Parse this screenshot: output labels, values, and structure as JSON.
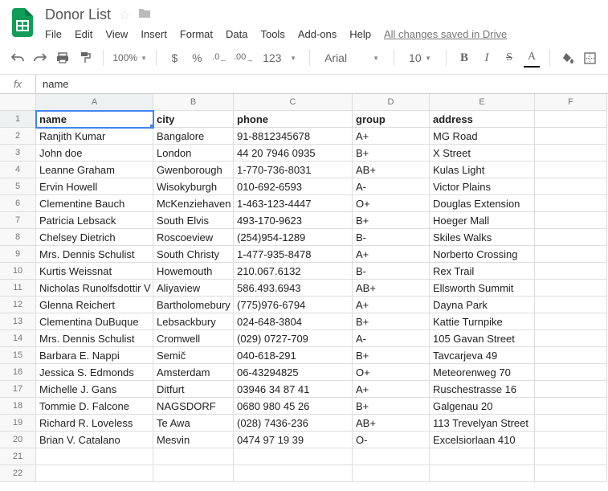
{
  "doc": {
    "title": "Donor List"
  },
  "menu": {
    "file": "File",
    "edit": "Edit",
    "view": "View",
    "insert": "Insert",
    "format": "Format",
    "data": "Data",
    "tools": "Tools",
    "addons": "Add-ons",
    "help": "Help",
    "saved": "All changes saved in Drive"
  },
  "toolbar": {
    "zoom": "100%",
    "currency": "$",
    "percent": "%",
    "dec_dec": ".0",
    "dec_inc": ".00",
    "numfmt": "123",
    "font": "Arial",
    "size": "10",
    "bold": "B",
    "italic": "I",
    "strike": "S",
    "textcolor": "A"
  },
  "formula": {
    "fx": "fx",
    "value": "name"
  },
  "columns": [
    "A",
    "B",
    "C",
    "D",
    "E",
    "F"
  ],
  "rownums": [
    "1",
    "2",
    "3",
    "4",
    "5",
    "6",
    "7",
    "8",
    "9",
    "10",
    "11",
    "12",
    "13",
    "14",
    "15",
    "16",
    "17",
    "18",
    "19",
    "20",
    "21",
    "22"
  ],
  "headers": {
    "name": "name",
    "city": "city",
    "phone": "phone",
    "group": "group",
    "address": "address"
  },
  "rows": [
    {
      "name": "Ranjith Kumar",
      "city": "Bangalore",
      "phone": "91-8812345678",
      "group": "A+",
      "address": "MG Road"
    },
    {
      "name": "John doe",
      "city": "London",
      "phone": "44 20 7946 0935",
      "group": "B+",
      "address": "X Street"
    },
    {
      "name": "Leanne Graham",
      "city": "Gwenborough",
      "phone": "1-770-736-8031",
      "group": "AB+",
      "address": "Kulas Light"
    },
    {
      "name": "Ervin Howell",
      "city": "Wisokyburgh",
      "phone": "010-692-6593",
      "group": "A-",
      "address": "Victor Plains"
    },
    {
      "name": "Clementine Bauch",
      "city": "McKenziehaven",
      "phone": "1-463-123-4447",
      "group": "O+",
      "address": "Douglas Extension"
    },
    {
      "name": "Patricia Lebsack",
      "city": "South Elvis",
      "phone": "493-170-9623",
      "group": "B+",
      "address": "Hoeger Mall"
    },
    {
      "name": "Chelsey Dietrich",
      "city": "Roscoeview",
      "phone": "(254)954-1289",
      "group": "B-",
      "address": "Skiles Walks"
    },
    {
      "name": "Mrs. Dennis Schulist",
      "city": "South Christy",
      "phone": "1-477-935-8478",
      "group": "A+",
      "address": "Norberto Crossing"
    },
    {
      "name": "Kurtis Weissnat",
      "city": "Howemouth",
      "phone": "210.067.6132",
      "group": "B-",
      "address": "Rex Trail"
    },
    {
      "name": "Nicholas Runolfsdottir V",
      "city": "Aliyaview",
      "phone": "586.493.6943",
      "group": "AB+",
      "address": "Ellsworth Summit"
    },
    {
      "name": "Glenna Reichert",
      "city": "Bartholomebury",
      "phone": "(775)976-6794",
      "group": "A+",
      "address": "Dayna Park"
    },
    {
      "name": "Clementina DuBuque",
      "city": "Lebsackbury",
      "phone": "024-648-3804",
      "group": "B+",
      "address": "Kattie Turnpike"
    },
    {
      "name": "Mrs. Dennis Schulist",
      "city": "Cromwell",
      "phone": "(029) 0727-709",
      "group": "A-",
      "address": "105 Gavan Street"
    },
    {
      "name": "Barbara E. Nappi",
      "city": "Semič",
      "phone": "040-618-291",
      "group": "B+",
      "address": "Tavcarjeva 49"
    },
    {
      "name": "Jessica S. Edmonds",
      "city": "Amsterdam",
      "phone": "06-43294825",
      "group": "O+",
      "address": "Meteorenweg 70"
    },
    {
      "name": "Michelle J. Gans",
      "city": "Ditfurt",
      "phone": "03946 34 87 41",
      "group": "A+",
      "address": "Ruschestrasse 16"
    },
    {
      "name": "Tommie D. Falcone",
      "city": "NAGSDORF",
      "phone": "0680 980 45 26",
      "group": "B+",
      "address": "Galgenau 20"
    },
    {
      "name": "Richard R. Loveless",
      "city": "Te Awa",
      "phone": "(028) 7436-236",
      "group": "AB+",
      "address": "113 Trevelyan Street"
    },
    {
      "name": "Brian V. Catalano",
      "city": "Mesvin",
      "phone": "0474 97 19 39",
      "group": "O-",
      "address": "Excelsiorlaan 410"
    }
  ]
}
